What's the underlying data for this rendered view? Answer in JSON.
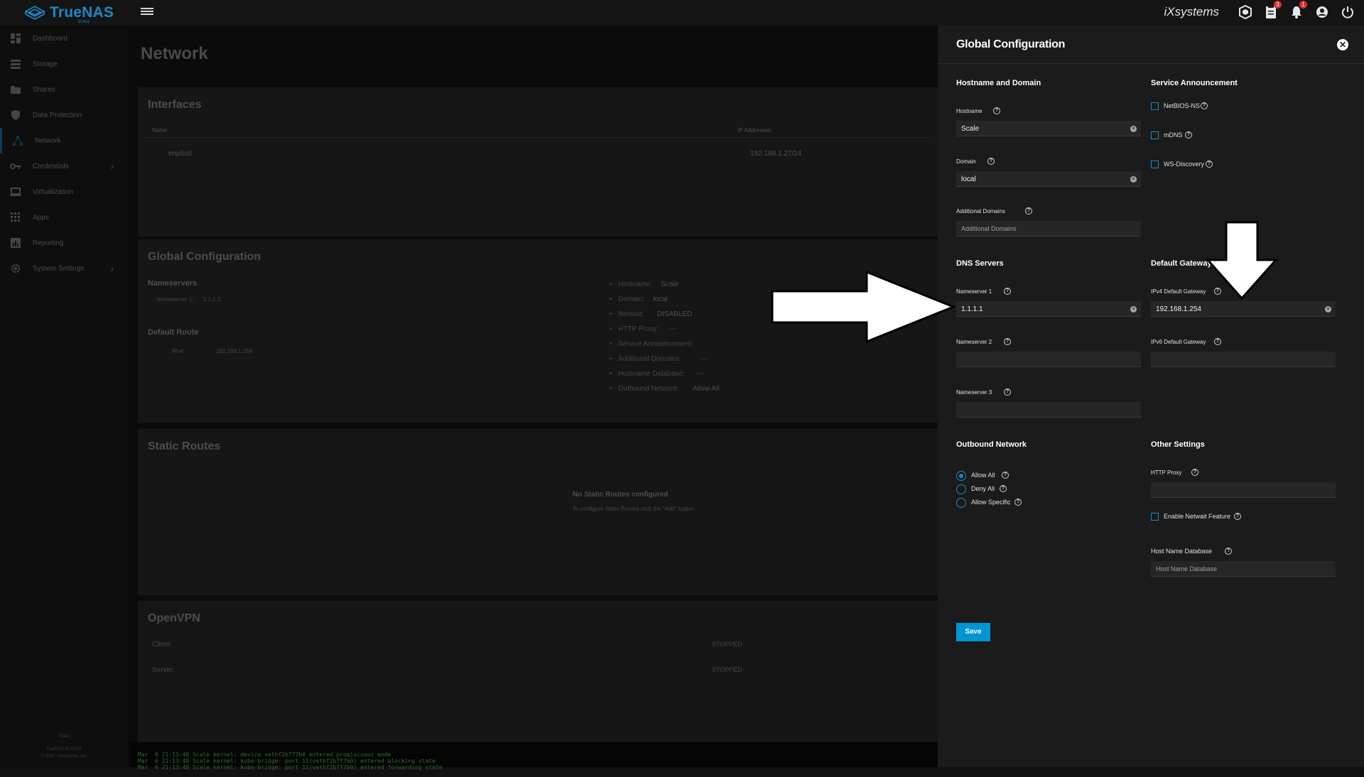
{
  "topbar": {
    "brand": "TrueNAS",
    "brand_sub": "SCALE",
    "vendor": "iXsystems",
    "tasks_badge": "3",
    "alerts_badge": "1"
  },
  "sidebar": {
    "items": [
      {
        "label": "Dashboard"
      },
      {
        "label": "Storage"
      },
      {
        "label": "Shares"
      },
      {
        "label": "Data Protection"
      },
      {
        "label": "Network"
      },
      {
        "label": "Credentials"
      },
      {
        "label": "Virtualization"
      },
      {
        "label": "Apps"
      },
      {
        "label": "Reporting"
      },
      {
        "label": "System Settings"
      }
    ],
    "footer_hostname": "Scale",
    "footer_version": "TrueNAS SCALE®",
    "footer_copyright": "© 2022 - iXsystems, Inc."
  },
  "main": {
    "page_title": "Network",
    "interfaces": {
      "title": "Interfaces",
      "col_name": "Name",
      "col_ip": "IP Addresses",
      "row_name": "enp5s0",
      "row_ip": "192.168.1.27/24"
    },
    "global_config": {
      "title": "Global Configuration",
      "nameservers_title": "Nameservers",
      "ns1_label": "Nameserver 1:",
      "ns1_value": "1.1.1.1",
      "default_route_title": "Default Route",
      "ipv4_label": "IPv4:",
      "ipv4_value": "192.168.1.254",
      "info": [
        {
          "k": "Hostname:",
          "v": "Scale"
        },
        {
          "k": "Domain:",
          "v": "local"
        },
        {
          "k": "Netwait:",
          "v": "DISABLED"
        },
        {
          "k": "HTTP Proxy:",
          "v": "---"
        },
        {
          "k": "Service Announcement:",
          "v": ""
        },
        {
          "k": "Additional Domains:",
          "v": "---"
        },
        {
          "k": "Hostname Database:",
          "v": "---"
        },
        {
          "k": "Outbound Network:",
          "v": "Allow All"
        }
      ]
    },
    "static_routes": {
      "title": "Static Routes",
      "empty_title": "No Static Routes configured",
      "empty_sub": "To configure Static Routes click the \"Add\" button."
    },
    "openvpn": {
      "title": "OpenVPN",
      "client_label": "Client",
      "client_status": "STOPPED",
      "server_label": "Server",
      "server_status": "STOPPED"
    }
  },
  "terminal": {
    "lines": [
      "Mar  6 21:13:48 Scale kernel: device vethf2b7f7b0 entered promiscuous mode",
      "Mar  6 21:13:48 Scale kernel: kube-bridge: port 11(vethf2b7f7b0) entered blocking state",
      "Mar  6 21:13:48 Scale kernel: kube-bridge: port 11(vethf2b7f7b0) entered forwarding state"
    ]
  },
  "panel": {
    "title": "Global Configuration",
    "hostname_domain_title": "Hostname and Domain",
    "hostname_label": "Hostname",
    "hostname_value": "Scale",
    "domain_label": "Domain",
    "domain_value": "local",
    "additional_domains_label": "Additional Domains",
    "additional_domains_placeholder": "Additional Domains",
    "service_announcement_title": "Service Announcement",
    "netbios_label": "NetBIOS-NS",
    "mdns_label": "mDNS",
    "wsd_label": "WS-Discovery",
    "dns_title": "DNS Servers",
    "ns1_label": "Nameserver 1",
    "ns1_value": "1.1.1.1",
    "ns2_label": "Nameserver 2",
    "ns3_label": "Nameserver 3",
    "gateway_title": "Default Gateway",
    "ipv4_gw_label": "IPv4 Default Gateway",
    "ipv4_gw_value": "192.168.1.254",
    "ipv6_gw_label": "IPv6 Default Gateway",
    "outbound_title": "Outbound Network",
    "allow_all": "Allow All",
    "deny_all": "Deny All",
    "allow_specific": "Allow Specific",
    "other_title": "Other Settings",
    "http_proxy_label": "HTTP Proxy",
    "netwait_label": "Enable Netwait Feature",
    "host_db_label": "Host Name Database",
    "host_db_placeholder": "Host Name Database",
    "save_label": "Save"
  },
  "colors": {
    "accent": "#0095d5",
    "panel_bg": "#1b1b1b",
    "badge": "#d32f2f"
  }
}
